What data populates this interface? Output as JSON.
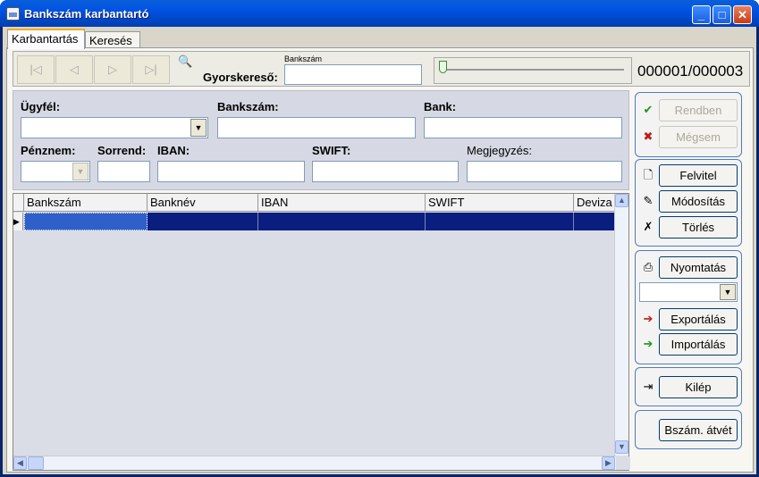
{
  "window": {
    "title": "Bankszám karbantartó"
  },
  "tabs": [
    {
      "label": "Karbantartás"
    },
    {
      "label": "Keresés"
    }
  ],
  "navigator": {
    "first": "|◁",
    "prev": "◁",
    "next": "▷",
    "last": "▷|",
    "quicksearch_caption": "Bankszám",
    "quicksearch_label": "Gyorskereső:",
    "quicksearch_value": "",
    "record_counter": "000001/000003",
    "position_fraction": 0.0
  },
  "filter": {
    "ugyfel_label": "Ügyfél:",
    "bankszam_label": "Bankszám:",
    "bank_label": "Bank:",
    "penznem_label": "Pénznem:",
    "sorrend_label": "Sorrend:",
    "iban_label": "IBAN:",
    "swift_label": "SWIFT:",
    "megjegyzes_label": "Megjegyzés:"
  },
  "grid": {
    "columns": [
      "Bankszám",
      "Banknév",
      "IBAN",
      "SWIFT",
      "Deviza"
    ],
    "rows": [
      [
        "",
        "",
        "",
        "",
        ""
      ]
    ]
  },
  "actions": {
    "rendben": "Rendben",
    "megsem": "Mégsem",
    "felvitel": "Felvitel",
    "modositas": "Módosítás",
    "torles": "Törlés",
    "nyomtatas": "Nyomtatás",
    "print_select_value": "",
    "exportalas": "Exportálás",
    "importalas": "Importálás",
    "kilep": "Kilép",
    "bszam_atvet": "Bszám. átvét"
  },
  "icons": {
    "check": "✔",
    "cross": "✖",
    "new": "🗋",
    "edit": "✎",
    "delete": "✗",
    "print": "⎙",
    "export": "➔",
    "import": "➔",
    "exit": "⇥",
    "search": "🔍"
  },
  "colors": {
    "title_bar": "#0054e3",
    "selection": "#0a1e80",
    "check": "#1a9a1a",
    "cross": "#c01818"
  }
}
